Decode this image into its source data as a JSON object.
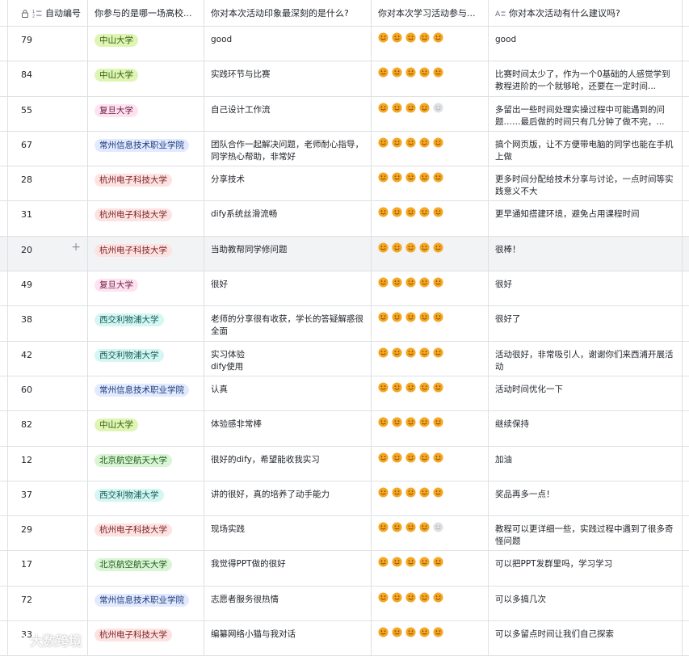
{
  "columns": {
    "id": "自动编号",
    "school": "你参与的是哪一场高校...",
    "impression": "你对本次活动印象最深刻的是什么?",
    "rating": "你对本次学习活动参与...",
    "suggestion": "你对本次活动有什么建议吗?"
  },
  "rows": [
    {
      "id": "79",
      "school": "中山大学",
      "impression": "good",
      "rating": 5,
      "suggestion": "good"
    },
    {
      "id": "84",
      "school": "中山大学",
      "impression": "实践环节与比赛",
      "rating": 5,
      "suggestion": "比赛时间太少了，作为一个0基础的人感觉学到教程进阶的一个就够呛，还要在一定时间..."
    },
    {
      "id": "55",
      "school": "复旦大学",
      "impression": "自己设计工作流",
      "rating": 4,
      "suggestion": "多留出一些时间处理实操过程中可能遇到的问题……最后做的时间只有几分钟了做不完，..."
    },
    {
      "id": "67",
      "school": "常州信息技术职业学院",
      "impression": "团队合作一起解决问题，老师耐心指导，同学热心帮助，非常好",
      "rating": 5,
      "suggestion": "搞个网页版，让不方便带电脑的同学也能在手机上做"
    },
    {
      "id": "28",
      "school": "杭州电子科技大学",
      "impression": "分享技术",
      "rating": 5,
      "suggestion": "更多时间分配给技术分享与讨论，一点时间等实践意义不大"
    },
    {
      "id": "31",
      "school": "杭州电子科技大学",
      "impression": "dify系统丝滑流畅",
      "rating": 5,
      "suggestion": "更早通知搭建环境，避免占用课程时间"
    },
    {
      "id": "20",
      "school": "杭州电子科技大学",
      "impression": "当助教帮同学修问题",
      "rating": 5,
      "suggestion": "很棒！"
    },
    {
      "id": "49",
      "school": "复旦大学",
      "impression": "很好",
      "rating": 5,
      "suggestion": "很好"
    },
    {
      "id": "38",
      "school": "西交利物浦大学",
      "impression": "老师的分享很有收获，学长的答疑解惑很全面",
      "rating": 5,
      "suggestion": "很好了"
    },
    {
      "id": "42",
      "school": "西交利物浦大学",
      "impression": "实习体验\ndify使用",
      "rating": 5,
      "suggestion": "活动很好，非常吸引人，谢谢你们来西浦开展活动"
    },
    {
      "id": "60",
      "school": "常州信息技术职业学院",
      "impression": "认真",
      "rating": 5,
      "suggestion": "活动时间优化一下"
    },
    {
      "id": "82",
      "school": "中山大学",
      "impression": "体验感非常棒",
      "rating": 5,
      "suggestion": "继续保持"
    },
    {
      "id": "12",
      "school": "北京航空航天大学",
      "impression": "很好的dify，希望能收我实习",
      "rating": 5,
      "suggestion": "加油"
    },
    {
      "id": "37",
      "school": "西交利物浦大学",
      "impression": "讲的很好，真的培养了动手能力",
      "rating": 5,
      "suggestion": "奖品再多一点！"
    },
    {
      "id": "29",
      "school": "杭州电子科技大学",
      "impression": "现场实践",
      "rating": 4,
      "suggestion": "教程可以更详细一些，实践过程中遇到了很多奇怪问题"
    },
    {
      "id": "17",
      "school": "北京航空航天大学",
      "impression": "我觉得PPT做的很好",
      "rating": 5,
      "suggestion": "可以把PPT发群里吗，学习学习"
    },
    {
      "id": "72",
      "school": "常州信息技术职业学院",
      "impression": "志愿者服务很热情",
      "rating": 5,
      "suggestion": "可以多搞几次"
    },
    {
      "id": "33",
      "school": "杭州电子科技大学",
      "impression": "编纂网络小猫与我对话",
      "rating": 5,
      "suggestion": "可以多留点时间让我们自己探索"
    }
  ],
  "school_tag_colors": {
    "中山大学": {
      "bg": "#dff5b3",
      "fg": "#2e5c0e"
    },
    "复旦大学": {
      "bg": "#fde2ef",
      "fg": "#6e1a44"
    },
    "常州信息技术职业学院": {
      "bg": "#e1eaff",
      "fg": "#1f3b7a"
    },
    "杭州电子科技大学": {
      "bg": "#fde2e2",
      "fg": "#7a1f1f"
    },
    "西交利物浦大学": {
      "bg": "#d5f6f2",
      "fg": "#0e5c52"
    },
    "北京航空航天大学": {
      "bg": "#d9f5d6",
      "fg": "#1e5c19"
    }
  },
  "rating_max": 5,
  "colors": {
    "star_on": "#f5a623",
    "star_off": "#dee0e3"
  },
  "hover_row_id": "20",
  "watermark": "大数跨境"
}
